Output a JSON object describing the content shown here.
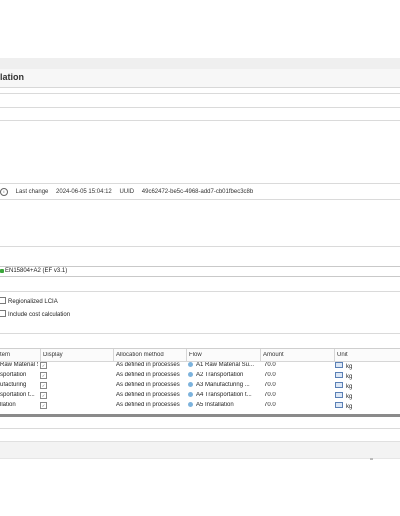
{
  "editor": {
    "title": "lation"
  },
  "info": {
    "last_change_label": "Last change",
    "last_change_value": "2024-06-05 15:04:12",
    "uuid_label": "UUID",
    "uuid_value": "49c62472-be5c-4968-add7-cb01fbec3c8b"
  },
  "calc": {
    "method": "EN15804+A2 (EF v3.1)",
    "regionalized_label": "Regionalized LCIA",
    "cost_label": "Include cost calculation"
  },
  "table": {
    "headers": [
      "tem",
      "Display",
      "Allocation method",
      "Flow",
      "Amount",
      "Unit"
    ],
    "rows": [
      {
        "item": "Raw Material Su...",
        "allocation": "As defined in processes",
        "flow": "A1 Raw Material Su...",
        "amount": "70.0",
        "unit": "kg"
      },
      {
        "item": "sportation",
        "allocation": "As defined in processes",
        "flow": "A2 Transportation",
        "amount": "70.0",
        "unit": "kg"
      },
      {
        "item": "ufacturing",
        "allocation": "As defined in processes",
        "flow": "A3 Manufacturing ...",
        "amount": "70.0",
        "unit": "kg"
      },
      {
        "item": "sportation t...",
        "allocation": "As defined in processes",
        "flow": "A4 Transportation t...",
        "amount": "70.0",
        "unit": "kg"
      },
      {
        "item": "llation",
        "allocation": "As defined in processes",
        "flow": "A5 Installation",
        "amount": "70.0",
        "unit": "kg"
      }
    ]
  },
  "colors": {
    "accent_green": "#3aa63a",
    "flow_blue": "#7db3dd"
  },
  "icons": {
    "info": "info-icon",
    "method": "method-icon",
    "display": "checkbox-icon",
    "flow": "flow-icon",
    "unit": "unit-icon"
  }
}
